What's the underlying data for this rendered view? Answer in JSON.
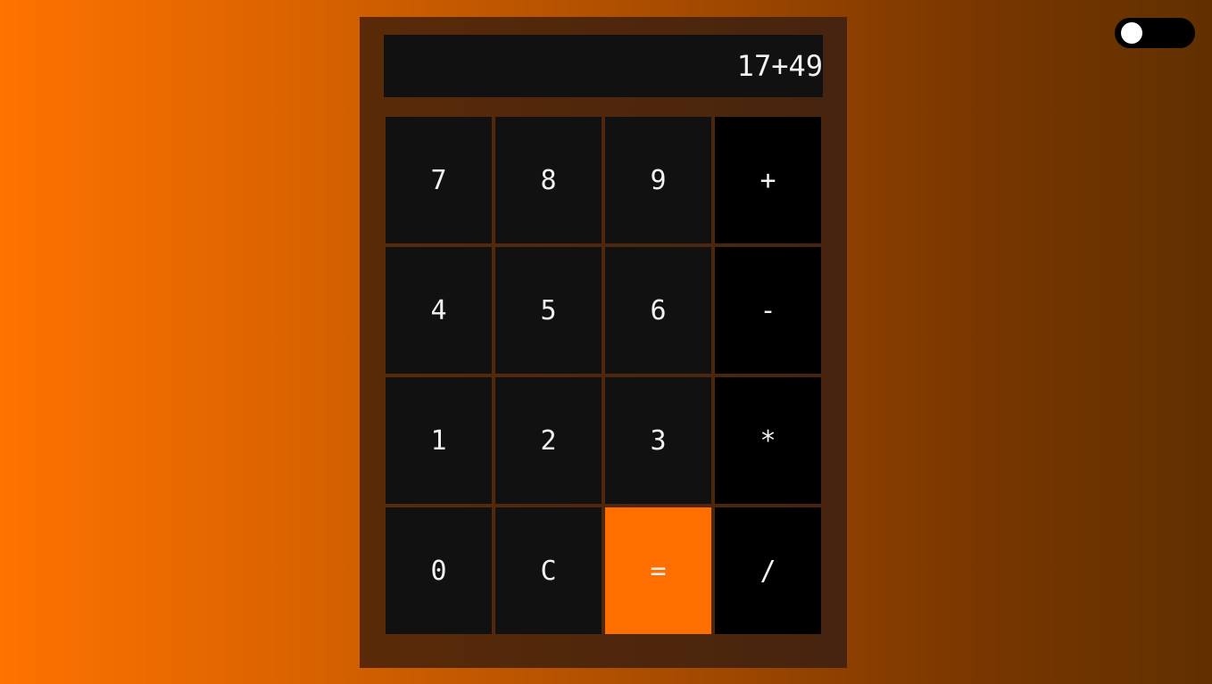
{
  "theme_toggle": {
    "state": "off",
    "colors": {
      "track": "#000000",
      "knob": "#ffffff"
    }
  },
  "display": {
    "value": "17+49"
  },
  "keys": [
    {
      "label": "7",
      "kind": "digit"
    },
    {
      "label": "8",
      "kind": "digit"
    },
    {
      "label": "9",
      "kind": "digit"
    },
    {
      "label": "+",
      "kind": "operator"
    },
    {
      "label": "4",
      "kind": "digit"
    },
    {
      "label": "5",
      "kind": "digit"
    },
    {
      "label": "6",
      "kind": "digit"
    },
    {
      "label": "-",
      "kind": "operator"
    },
    {
      "label": "1",
      "kind": "digit"
    },
    {
      "label": "2",
      "kind": "digit"
    },
    {
      "label": "3",
      "kind": "digit"
    },
    {
      "label": "*",
      "kind": "operator"
    },
    {
      "label": "0",
      "kind": "digit"
    },
    {
      "label": "C",
      "kind": "clear"
    },
    {
      "label": "=",
      "kind": "equals"
    },
    {
      "label": "/",
      "kind": "operator"
    }
  ],
  "colors": {
    "accent": "#ff6f00",
    "key_background": "#111111",
    "operator_background": "#000000",
    "key_text": "#f2f2f2",
    "calculator_frame": "#5a2a08"
  }
}
